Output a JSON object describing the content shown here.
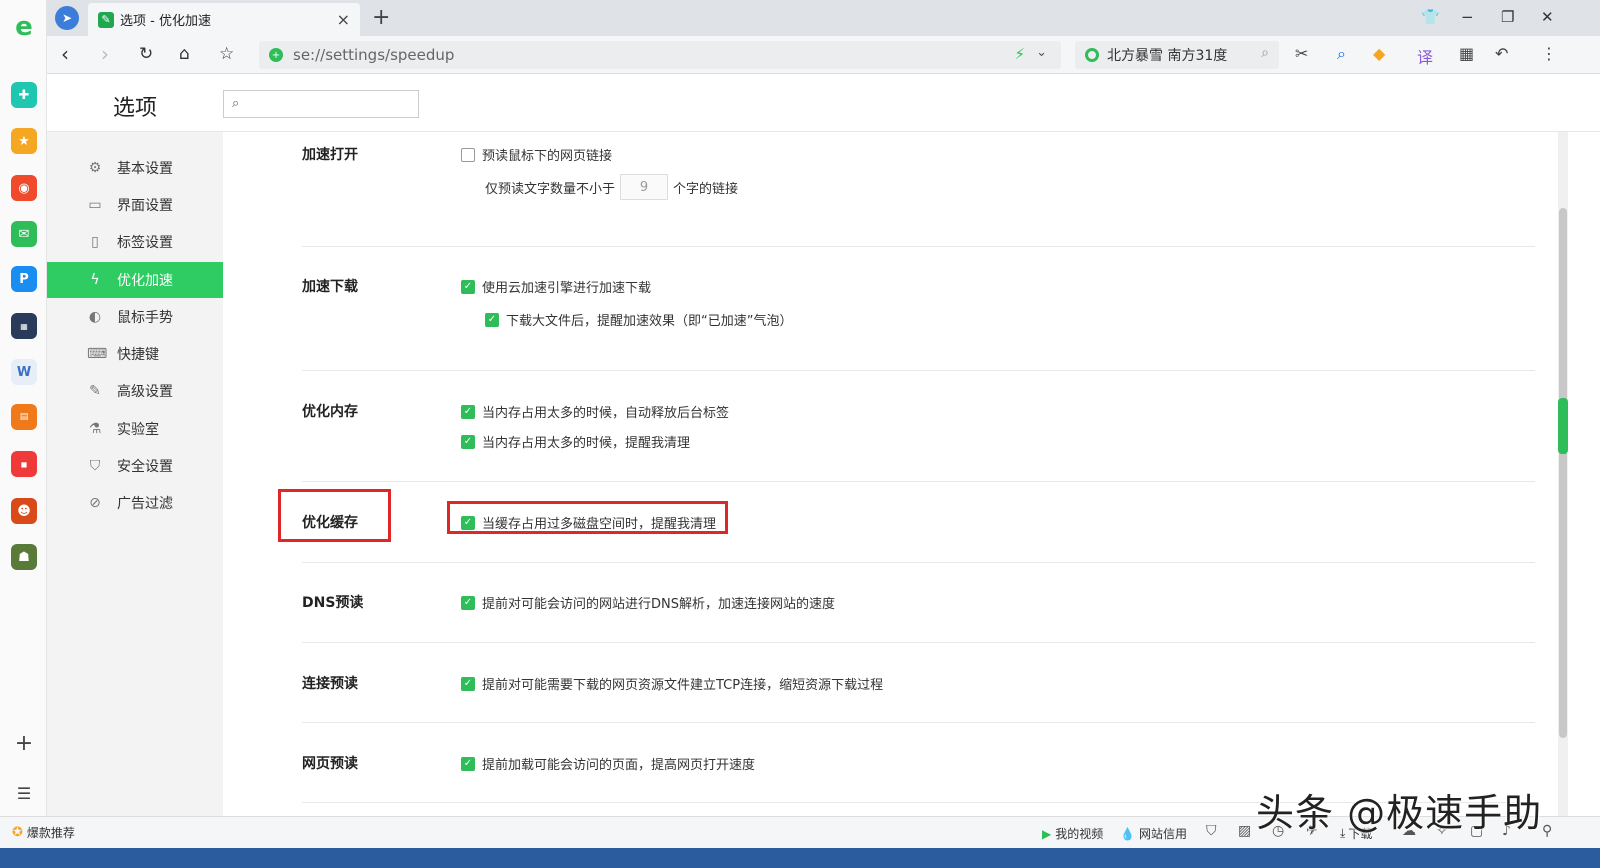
{
  "tab": {
    "title": "选项 - 优化加速",
    "close": "×",
    "new": "+"
  },
  "window_controls": {
    "restore_shirt": "⬚",
    "min": "−",
    "max": "❐",
    "close": "✕"
  },
  "addressbar": {
    "url": "se://settings/speedup",
    "search_text": "北方暴雪 南方31度"
  },
  "options": {
    "title": "选项",
    "search_placeholder": ""
  },
  "nav": [
    {
      "label": "基本设置",
      "icon": "gear-icon"
    },
    {
      "label": "界面设置",
      "icon": "window-icon"
    },
    {
      "label": "标签设置",
      "icon": "tab-icon"
    },
    {
      "label": "优化加速",
      "icon": "bolt-icon",
      "active": true
    },
    {
      "label": "鼠标手势",
      "icon": "mouse-icon"
    },
    {
      "label": "快捷键",
      "icon": "keyboard-icon"
    },
    {
      "label": "高级设置",
      "icon": "wrench-icon"
    },
    {
      "label": "实验室",
      "icon": "flask-icon"
    },
    {
      "label": "安全设置",
      "icon": "shield-icon"
    },
    {
      "label": "广告过滤",
      "icon": "block-icon"
    }
  ],
  "sections": {
    "open": {
      "title": "加速打开",
      "opt1": "预读鼠标下的网页链接",
      "opt1_checked": false,
      "min_prefix": "仅预读文字数量不小于",
      "min_value": "9",
      "min_suffix": "个字的链接"
    },
    "download": {
      "title": "加速下载",
      "opt1": "使用云加速引擎进行加速下载",
      "opt2": "下载大文件后，提醒加速效果（即“已加速”气泡）"
    },
    "memory": {
      "title": "优化内存",
      "opt1": "当内存占用太多的时候，自动释放后台标签",
      "opt2": "当内存占用太多的时候，提醒我清理"
    },
    "cache": {
      "title": "优化缓存",
      "opt1": "当缓存占用过多磁盘空间时，提醒我清理"
    },
    "dns": {
      "title": "DNS预读",
      "opt1": "提前对可能会访问的网站进行DNS解析，加速连接网站的速度"
    },
    "connect": {
      "title": "连接预读",
      "opt1": "提前对可能需要下载的网页资源文件建立TCP连接，缩短资源下载过程"
    },
    "page": {
      "title": "网页预读",
      "opt1": "提前加载可能会访问的页面，提高网页打开速度"
    }
  },
  "statusbar": {
    "hot": "爆款推荐",
    "my_video": "我的视频",
    "site_credit": "网站信用",
    "download": "下载"
  },
  "watermark": "头条 @极速手助",
  "colors": {
    "accent": "#2ECC63",
    "check": "#2EBD59",
    "highlight": "#E02727"
  }
}
